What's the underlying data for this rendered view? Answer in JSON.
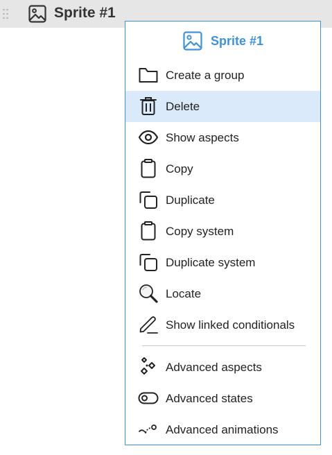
{
  "row": {
    "title": "Sprite #1",
    "icon": "image-icon",
    "handle_icon": "drag-handle-icon"
  },
  "menu": {
    "title": "Sprite #1",
    "title_icon": "image-icon",
    "accent_color": "#3b93e0",
    "highlight_color": "#dbeafa",
    "items": [
      {
        "label": "Create a group",
        "icon": "folder-icon",
        "highlighted": false
      },
      {
        "label": "Delete",
        "icon": "trash-icon",
        "highlighted": true
      },
      {
        "label": "Show aspects",
        "icon": "eye-icon",
        "highlighted": false
      },
      {
        "label": "Copy",
        "icon": "clipboard-icon",
        "highlighted": false
      },
      {
        "label": "Duplicate",
        "icon": "duplicate-icon",
        "highlighted": false
      },
      {
        "label": "Copy system",
        "icon": "clipboard-icon",
        "highlighted": false
      },
      {
        "label": "Duplicate system",
        "icon": "duplicate-icon",
        "highlighted": false
      },
      {
        "label": "Locate",
        "icon": "magnifier-icon",
        "highlighted": false
      },
      {
        "label": "Show linked conditionals",
        "icon": "pen-icon",
        "highlighted": false
      },
      {
        "label": "Advanced aspects",
        "icon": "sparkle-diamonds-icon",
        "highlighted": false
      },
      {
        "label": "Advanced states",
        "icon": "toggle-icon",
        "highlighted": false
      },
      {
        "label": "Advanced animations",
        "icon": "animation-curve-icon",
        "highlighted": false
      }
    ]
  }
}
